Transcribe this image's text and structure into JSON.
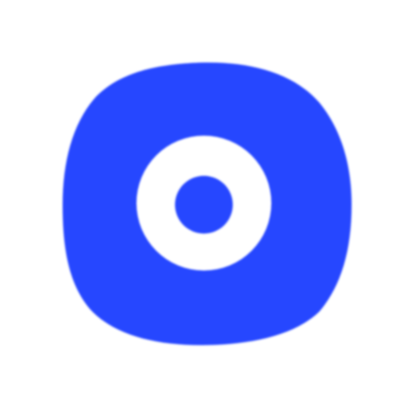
{
  "icon": {
    "name": "target-icon",
    "colors": {
      "primary": "#2746FF",
      "background": "#FFFFFF",
      "ring": "#FFFFFF"
    }
  }
}
